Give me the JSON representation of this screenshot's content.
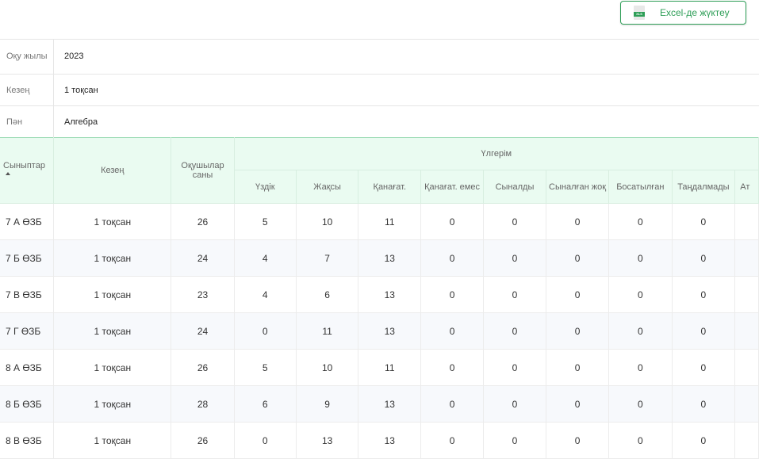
{
  "toolbar": {
    "excel_button": "Excel-де жүктеу",
    "xls_icon_text": "XLS"
  },
  "filters": [
    {
      "label": "Оқу жылы",
      "value": "2023"
    },
    {
      "label": "Кезең",
      "value": "1 тоқсан"
    },
    {
      "label": "Пән",
      "value": "Алгебра"
    }
  ],
  "table": {
    "headers": {
      "classes": "Сыныптар",
      "period": "Кезең",
      "students": "Оқушылар саны",
      "progress_group": "Үлгерім",
      "excellent": "Үздік",
      "good": "Жақсы",
      "satisfactory": "Қанағат.",
      "unsatisfactory": "Қанағат. емес",
      "passed": "Сыналды",
      "not_passed": "Сыналған жоқ",
      "exempt": "Босатылған",
      "not_selected": "Таңдалмады",
      "cut": "Ат"
    },
    "rows": [
      {
        "class": "7 А ӨЗБ",
        "period": "1 тоқсан",
        "students": "26",
        "excellent": "5",
        "good": "10",
        "satisfactory": "11",
        "unsatisfactory": "0",
        "passed": "0",
        "not_passed": "0",
        "exempt": "0",
        "not_selected": "0"
      },
      {
        "class": "7 Б ӨЗБ",
        "period": "1 тоқсан",
        "students": "24",
        "excellent": "4",
        "good": "7",
        "satisfactory": "13",
        "unsatisfactory": "0",
        "passed": "0",
        "not_passed": "0",
        "exempt": "0",
        "not_selected": "0"
      },
      {
        "class": "7 В ӨЗБ",
        "period": "1 тоқсан",
        "students": "23",
        "excellent": "4",
        "good": "6",
        "satisfactory": "13",
        "unsatisfactory": "0",
        "passed": "0",
        "not_passed": "0",
        "exempt": "0",
        "not_selected": "0"
      },
      {
        "class": "7 Г ӨЗБ",
        "period": "1 тоқсан",
        "students": "24",
        "excellent": "0",
        "good": "11",
        "satisfactory": "13",
        "unsatisfactory": "0",
        "passed": "0",
        "not_passed": "0",
        "exempt": "0",
        "not_selected": "0"
      },
      {
        "class": "8 А ӨЗБ",
        "period": "1 тоқсан",
        "students": "26",
        "excellent": "5",
        "good": "10",
        "satisfactory": "11",
        "unsatisfactory": "0",
        "passed": "0",
        "not_passed": "0",
        "exempt": "0",
        "not_selected": "0"
      },
      {
        "class": "8 Б ӨЗБ",
        "period": "1 тоқсан",
        "students": "28",
        "excellent": "6",
        "good": "9",
        "satisfactory": "13",
        "unsatisfactory": "0",
        "passed": "0",
        "not_passed": "0",
        "exempt": "0",
        "not_selected": "0"
      },
      {
        "class": "8 В ӨЗБ",
        "period": "1 тоқсан",
        "students": "26",
        "excellent": "0",
        "good": "13",
        "satisfactory": "13",
        "unsatisfactory": "0",
        "passed": "0",
        "not_passed": "0",
        "exempt": "0",
        "not_selected": "0"
      }
    ]
  },
  "colors": {
    "accent": "#2e9e57",
    "header_bg": "#eafbf1",
    "row_alt": "#f7f9fc"
  }
}
